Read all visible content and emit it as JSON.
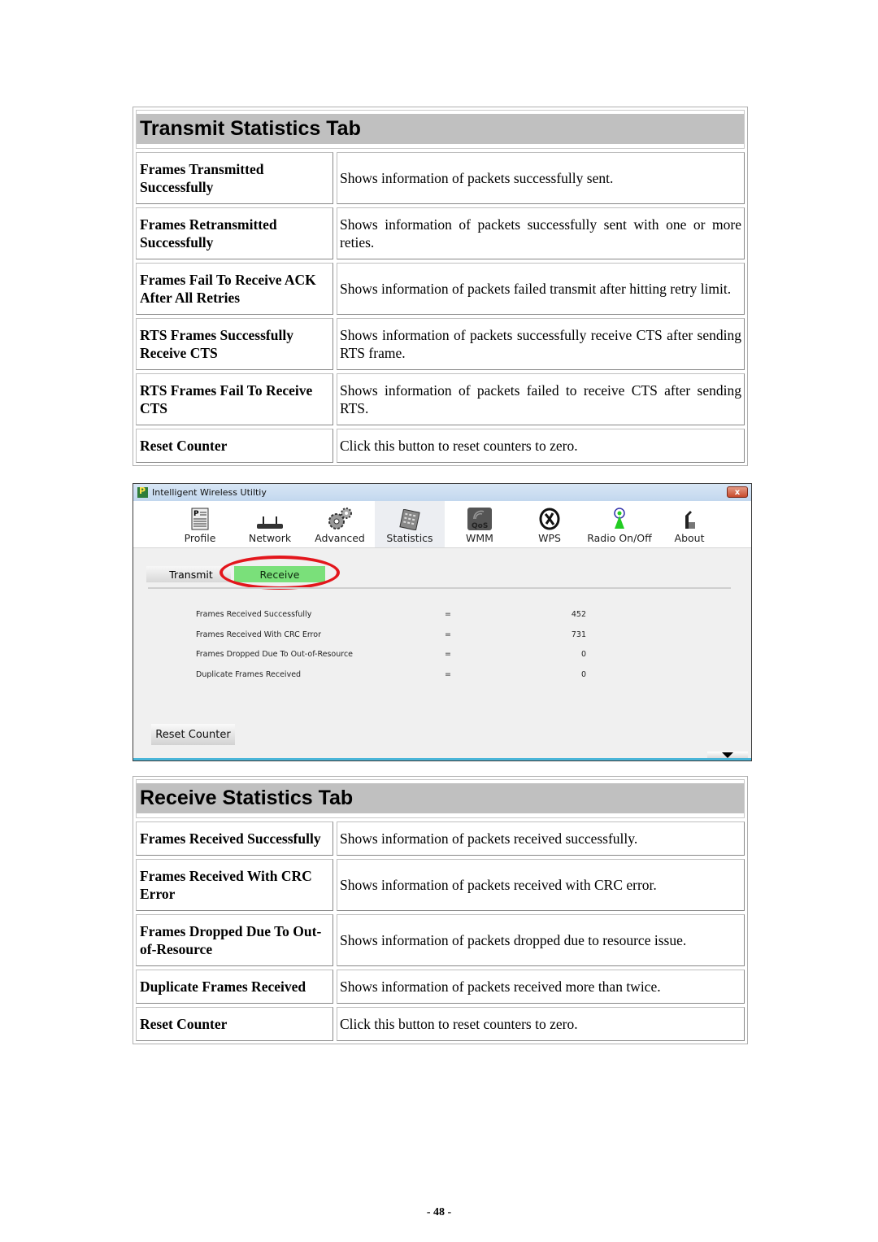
{
  "transmit_table": {
    "title": "Transmit Statistics Tab",
    "rows": [
      {
        "term": "Frames Transmitted Successfully",
        "desc": "Shows information of packets successfully sent."
      },
      {
        "term": "Frames Retransmitted Successfully",
        "desc": "Shows information of packets successfully sent with one or more reties."
      },
      {
        "term": "Frames Fail To Receive ACK After All Retries",
        "desc": "Shows information of packets failed transmit after hitting retry limit."
      },
      {
        "term": "RTS Frames Successfully Receive CTS",
        "desc": "Shows information of packets successfully receive CTS after sending RTS frame."
      },
      {
        "term": "RTS Frames Fail To Receive CTS",
        "desc": "Shows information of packets failed to receive CTS after sending RTS."
      },
      {
        "term": "Reset Counter",
        "desc": "Click this button to reset counters to zero."
      }
    ]
  },
  "app": {
    "title": "Intelligent Wireless Utiltiy",
    "close_label": "x",
    "toolbar": [
      {
        "label": "Profile",
        "icon": "profile-icon"
      },
      {
        "label": "Network",
        "icon": "network-icon"
      },
      {
        "label": "Advanced",
        "icon": "gears-icon"
      },
      {
        "label": "Statistics",
        "icon": "statistics-icon",
        "active": true
      },
      {
        "label": "WMM",
        "icon": "qos-icon"
      },
      {
        "label": "WPS",
        "icon": "wps-icon"
      },
      {
        "label": "Radio On/Off",
        "icon": "radio-icon"
      },
      {
        "label": "About",
        "icon": "about-icon"
      }
    ],
    "tabs": {
      "transmit": "Transmit",
      "receive": "Receive",
      "active": "receive"
    },
    "stats": [
      {
        "label": "Frames Received Successfully",
        "eq": "=",
        "value": "452"
      },
      {
        "label": "Frames Received With CRC Error",
        "eq": "=",
        "value": "731"
      },
      {
        "label": "Frames Dropped Due To Out-of-Resource",
        "eq": "=",
        "value": "0"
      },
      {
        "label": "Duplicate Frames Received",
        "eq": "=",
        "value": "0"
      }
    ],
    "reset_label": "Reset Counter",
    "colors": {
      "active_tab": "#7ae07a",
      "highlight_ring": "#e3161c",
      "title_bar": "#c2d7ee"
    }
  },
  "receive_table": {
    "title": "Receive Statistics Tab",
    "rows": [
      {
        "term": "Frames Received Successfully",
        "desc": "Shows information of packets received successfully."
      },
      {
        "term": "Frames Received With CRC Error",
        "desc": "Shows information of packets received with CRC error."
      },
      {
        "term": "Frames Dropped Due To Out-of-Resource",
        "desc": "Shows information of packets dropped due to resource issue."
      },
      {
        "term": "Duplicate Frames Received",
        "desc": "Shows information of packets received more than twice."
      },
      {
        "term": "Reset Counter",
        "desc": "Click this button to reset counters to zero."
      }
    ]
  },
  "page_number": "- 48 -"
}
